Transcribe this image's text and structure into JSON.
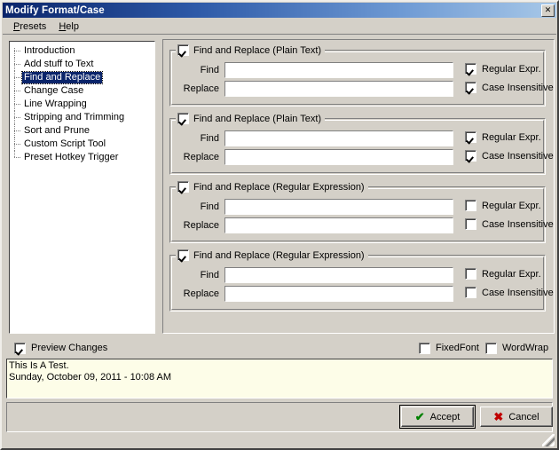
{
  "window": {
    "title": "Modify Format/Case",
    "close_label": "✕"
  },
  "menu": {
    "items": [
      {
        "label": "Presets",
        "accesskey": "P"
      },
      {
        "label": "Help",
        "accesskey": "H"
      }
    ]
  },
  "tree": {
    "items": [
      {
        "label": "Introduction",
        "selected": false
      },
      {
        "label": "Add stuff to Text",
        "selected": false
      },
      {
        "label": "Find and Replace",
        "selected": true
      },
      {
        "label": "Change Case",
        "selected": false
      },
      {
        "label": "Line Wrapping",
        "selected": false
      },
      {
        "label": "Stripping and Trimming",
        "selected": false
      },
      {
        "label": "Sort and Prune",
        "selected": false
      },
      {
        "label": "Custom Script Tool",
        "selected": false
      },
      {
        "label": "Preset Hotkey Trigger",
        "selected": false
      }
    ]
  },
  "groups": [
    {
      "title": "Find and Replace (Plain Text)",
      "enabled": true,
      "find_label": "Find",
      "find_value": "",
      "replace_label": "Replace",
      "replace_value": "",
      "regex_label": "Regular Expr.",
      "regex_checked": true,
      "case_label": "Case Insensitive",
      "case_checked": true
    },
    {
      "title": "Find and Replace (Plain Text)",
      "enabled": true,
      "find_label": "Find",
      "find_value": "",
      "replace_label": "Replace",
      "replace_value": "",
      "regex_label": "Regular Expr.",
      "regex_checked": true,
      "case_label": "Case Insensitive",
      "case_checked": true
    },
    {
      "title": "Find and Replace (Regular Expression)",
      "enabled": true,
      "find_label": "Find",
      "find_value": "",
      "replace_label": "Replace",
      "replace_value": "",
      "regex_label": "Regular Expr.",
      "regex_checked": false,
      "case_label": "Case Insensitive",
      "case_checked": false
    },
    {
      "title": "Find and Replace (Regular Expression)",
      "enabled": true,
      "find_label": "Find",
      "find_value": "",
      "replace_label": "Replace",
      "replace_value": "",
      "regex_label": "Regular Expr.",
      "regex_checked": false,
      "case_label": "Case Insensitive",
      "case_checked": false
    }
  ],
  "bottom": {
    "preview_changes_label": "Preview Changes",
    "preview_changes_checked": true,
    "fixedfont_label": "FixedFont",
    "fixedfont_checked": false,
    "wordwrap_label": "WordWrap",
    "wordwrap_checked": false
  },
  "preview": {
    "line1": "This Is A Test.",
    "line2": "Sunday, October 09, 2011 - 10:08 AM"
  },
  "buttons": {
    "accept_label": "Accept",
    "accept_icon": "✔",
    "cancel_label": "Cancel",
    "cancel_icon": "✖"
  },
  "colors": {
    "face": "#d4d0c8",
    "title_start": "#0a246a",
    "title_end": "#a8c8e8",
    "selection": "#0a246a",
    "preview_bg": "#fdfde8",
    "accept_icon": "#008000",
    "cancel_icon": "#c00000"
  }
}
